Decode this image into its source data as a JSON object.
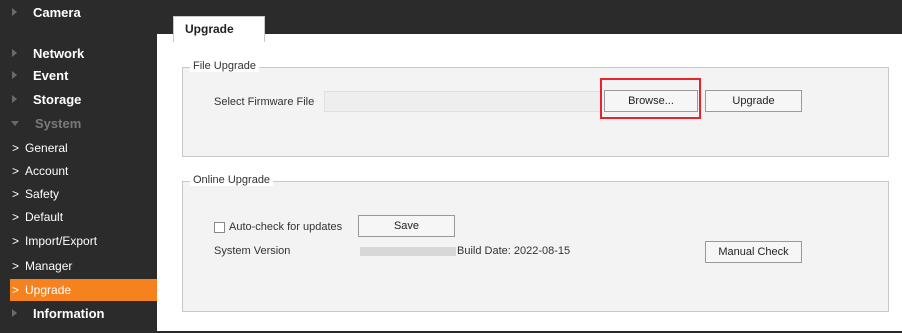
{
  "sidebar": {
    "items": [
      {
        "label": "Camera"
      },
      {
        "label": "Network"
      },
      {
        "label": "Event"
      },
      {
        "label": "Storage"
      },
      {
        "label": "System"
      }
    ],
    "system_sub": [
      {
        "label": "General"
      },
      {
        "label": "Account"
      },
      {
        "label": "Safety"
      },
      {
        "label": "Default"
      },
      {
        "label": "Import/Export"
      },
      {
        "label": "Manager"
      },
      {
        "label": "Upgrade"
      }
    ],
    "last_item": {
      "label": "Information"
    }
  },
  "tab": {
    "label": "Upgrade"
  },
  "file_upgrade": {
    "legend": "File Upgrade",
    "select_label": "Select Firmware File",
    "browse_label": "Browse...",
    "upgrade_label": "Upgrade"
  },
  "online_upgrade": {
    "legend": "Online Upgrade",
    "auto_check_label": "Auto-check for updates",
    "save_label": "Save",
    "system_version_label": "System Version",
    "build_date": "Build Date: 2022-08-15",
    "manual_check_label": "Manual Check"
  },
  "colors": {
    "sidebar_bg": "#2b2b2b",
    "active_bg": "#f5821f",
    "highlight": "#e8232a"
  }
}
